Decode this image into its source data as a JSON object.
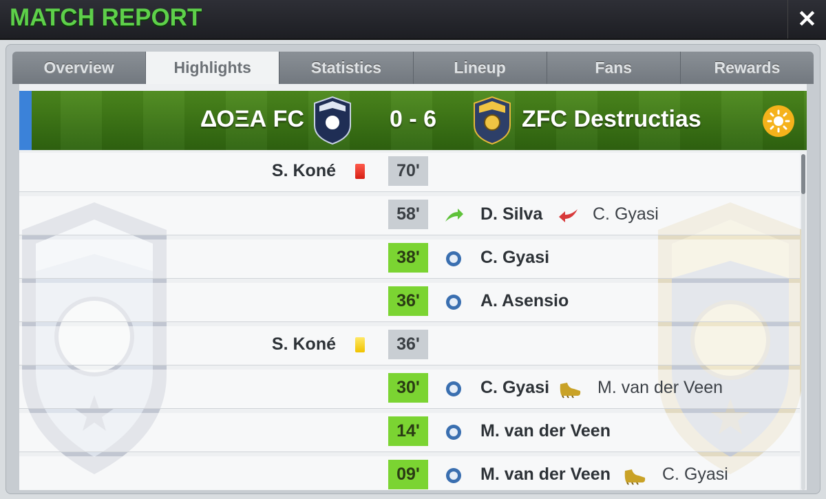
{
  "header": {
    "title": "MATCH REPORT",
    "close_label": "✕"
  },
  "tabs": [
    {
      "label": "Overview",
      "active": false
    },
    {
      "label": "Highlights",
      "active": true
    },
    {
      "label": "Statistics",
      "active": false
    },
    {
      "label": "Lineup",
      "active": false
    },
    {
      "label": "Fans",
      "active": false
    },
    {
      "label": "Rewards",
      "active": false
    }
  ],
  "match": {
    "home_team": "ΔΟΞΑ FC",
    "away_team": "ZFC Destructias",
    "score": "0 - 6",
    "weather_icon": "sun-icon",
    "colors": {
      "goal_minute": "#7bd432",
      "home_accent": "#3b82d9",
      "title": "#5ed04a"
    }
  },
  "events": [
    {
      "minute": "70'",
      "home_player": "S. Koné",
      "card": "red"
    },
    {
      "minute": "58'",
      "type": "substitution",
      "primary": "D. Silva",
      "secondary": "C. Gyasi"
    },
    {
      "minute": "38'",
      "type": "goal",
      "primary": "C. Gyasi"
    },
    {
      "minute": "36'",
      "type": "goal",
      "primary": "A. Asensio"
    },
    {
      "minute": "36'",
      "home_player": "S. Koné",
      "card": "yellow"
    },
    {
      "minute": "30'",
      "type": "goal",
      "primary": "C. Gyasi",
      "secondary": "M. van der Veen"
    },
    {
      "minute": "14'",
      "type": "goal",
      "primary": "M. van der Veen"
    },
    {
      "minute": "09'",
      "type": "goal",
      "primary": "M. van der Veen",
      "secondary": "C. Gyasi"
    }
  ]
}
